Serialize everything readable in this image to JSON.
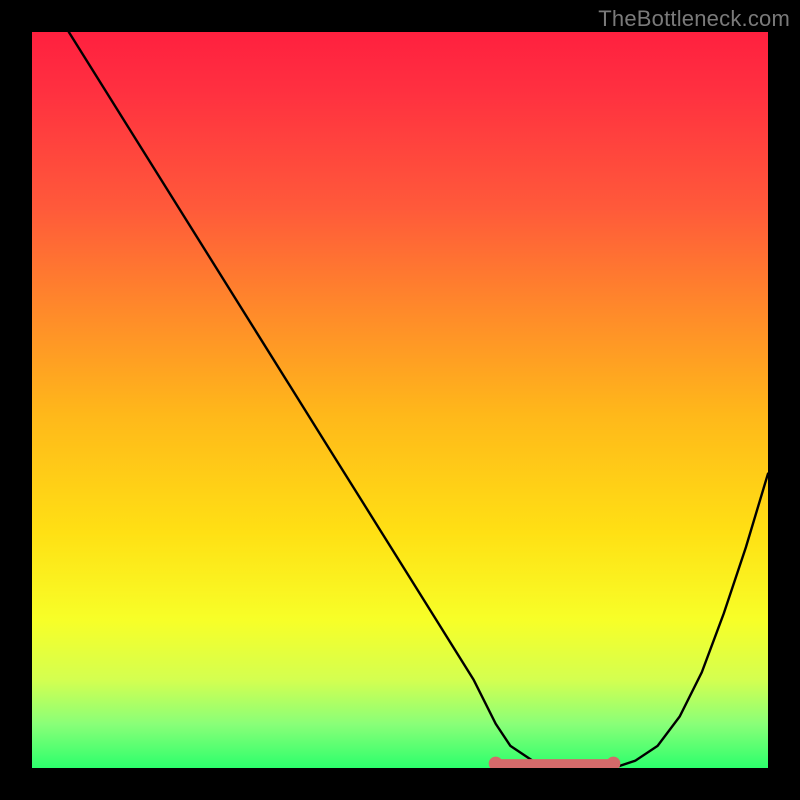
{
  "attribution": "TheBottleneck.com",
  "chart_data": {
    "type": "line",
    "title": "",
    "xlabel": "",
    "ylabel": "",
    "xlim": [
      0,
      100
    ],
    "ylim": [
      0,
      100
    ],
    "series": [
      {
        "name": "curve",
        "x": [
          5,
          10,
          15,
          20,
          25,
          30,
          35,
          40,
          45,
          50,
          55,
          60,
          63,
          65,
          68,
          72,
          76,
          79,
          82,
          85,
          88,
          91,
          94,
          97,
          100
        ],
        "values": [
          100,
          92,
          84,
          76,
          68,
          60,
          52,
          44,
          36,
          28,
          20,
          12,
          6,
          3,
          1,
          0,
          0,
          0,
          1,
          3,
          7,
          13,
          21,
          30,
          40
        ]
      },
      {
        "name": "floor-segment",
        "x": [
          63,
          79
        ],
        "values": [
          0.6,
          0.6
        ]
      }
    ],
    "annotations": [
      {
        "type": "dot",
        "x": 63,
        "y": 0.6
      },
      {
        "type": "dot",
        "x": 79,
        "y": 0.6
      }
    ],
    "colors": {
      "curve": "#000000",
      "floor": "#d46a6a",
      "gradient_top": "#ff203f",
      "gradient_bottom": "#2cff6c"
    }
  }
}
